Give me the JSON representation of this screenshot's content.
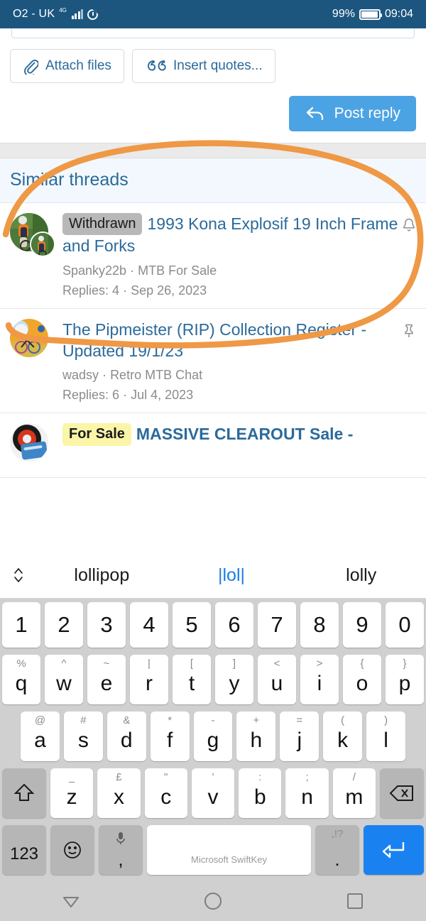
{
  "statusbar": {
    "carrier": "O2 - UK",
    "network_type": "4G",
    "alarm_icon": "alarm-icon",
    "battery_percent": "99%",
    "clock": "09:04"
  },
  "composer": {
    "attach_label": "Attach files",
    "attach_icon": "paperclip-icon",
    "quotes_label": "Insert quotes...",
    "quotes_icon": "quote-marks-icon",
    "post_label": "Post reply",
    "post_icon": "reply-arrow-icon",
    "post_button_color": "#4ba3e3"
  },
  "similar": {
    "heading": "Similar threads",
    "heading_color": "#2b6a9b",
    "threads": [
      {
        "badge": "Withdrawn",
        "badge_color": "#b8b8b8",
        "title": "1993 Kona Explosif 19 Inch Frame and Forks",
        "author": "Spanky22b",
        "forum": "MTB For Sale",
        "separator": "·",
        "replies": "Replies: 4",
        "date": "Sep 26, 2023",
        "status_icon": "bell-icon"
      },
      {
        "badge": "",
        "badge_color": "",
        "title": "The Pipmeister (RIP) Collection Register - Updated 19/1/23",
        "author": "wadsy",
        "forum": "Retro MTB Chat",
        "separator": "·",
        "replies": "Replies: 6",
        "date": "Jul 4, 2023",
        "status_icon": "pin-icon"
      },
      {
        "badge": "For Sale",
        "badge_color": "#fbf5a8",
        "title": "MASSIVE CLEAROUT Sale -",
        "author": "",
        "forum": "",
        "separator": "",
        "replies": "",
        "date": "",
        "status_icon": ""
      }
    ]
  },
  "annotation": {
    "type": "hand-drawn-circle",
    "color": "#ef9845"
  },
  "keyboard": {
    "brand": "Microsoft SwiftKey",
    "expand_icon": "chevron-updown-icon",
    "suggestions": [
      {
        "text": "lollipop",
        "current": false
      },
      {
        "text": "lol",
        "current": true
      },
      {
        "text": "lolly",
        "current": false
      }
    ],
    "rows": {
      "numbers": [
        "1",
        "2",
        "3",
        "4",
        "5",
        "6",
        "7",
        "8",
        "9",
        "0"
      ],
      "row1": [
        {
          "main": "q",
          "sub": "%"
        },
        {
          "main": "w",
          "sub": "^"
        },
        {
          "main": "e",
          "sub": "~"
        },
        {
          "main": "r",
          "sub": "|"
        },
        {
          "main": "t",
          "sub": "["
        },
        {
          "main": "y",
          "sub": "]"
        },
        {
          "main": "u",
          "sub": "<"
        },
        {
          "main": "i",
          "sub": ">"
        },
        {
          "main": "o",
          "sub": "{"
        },
        {
          "main": "p",
          "sub": "}"
        }
      ],
      "row2": [
        {
          "main": "a",
          "sub": "@"
        },
        {
          "main": "s",
          "sub": "#"
        },
        {
          "main": "d",
          "sub": "&"
        },
        {
          "main": "f",
          "sub": "*"
        },
        {
          "main": "g",
          "sub": "-"
        },
        {
          "main": "h",
          "sub": "+"
        },
        {
          "main": "j",
          "sub": "="
        },
        {
          "main": "k",
          "sub": "("
        },
        {
          "main": "l",
          "sub": ")"
        }
      ],
      "row3": [
        {
          "main": "z",
          "sub": "_"
        },
        {
          "main": "x",
          "sub": "£"
        },
        {
          "main": "c",
          "sub": "\""
        },
        {
          "main": "v",
          "sub": "'"
        },
        {
          "main": "b",
          "sub": ":"
        },
        {
          "main": "n",
          "sub": ";"
        },
        {
          "main": "m",
          "sub": "/"
        }
      ]
    },
    "shift_icon": "shift-arrow-icon",
    "backspace_icon": "backspace-icon",
    "numeric_label": "123",
    "emoji_icon": "emoji-smiley-icon",
    "mic_icon": "microphone-icon",
    "comma_label": ",",
    "period_sub": ",!?",
    "period_label": ".",
    "enter_icon": "enter-arrow-icon",
    "enter_color": "#1a82f0"
  },
  "navbar": {
    "back_icon": "back-triangle-icon",
    "home_icon": "home-circle-icon",
    "recents_icon": "recents-square-icon"
  }
}
